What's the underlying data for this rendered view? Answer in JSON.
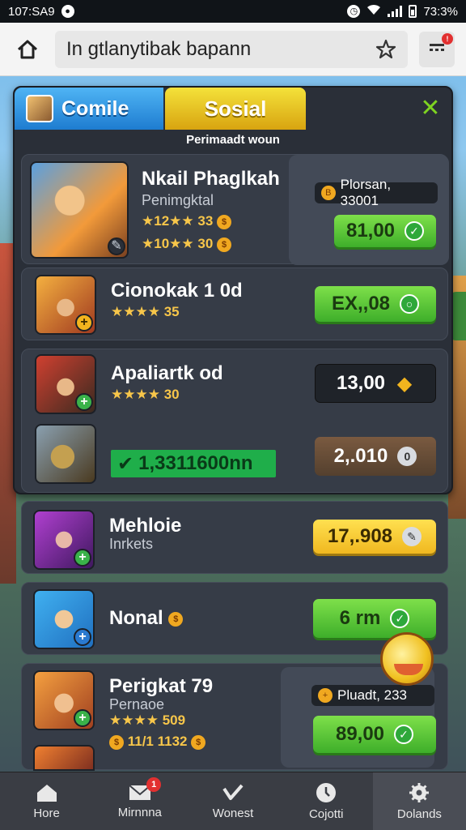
{
  "status_bar": {
    "time": "107:SA9",
    "right_text": "73:3%"
  },
  "browser": {
    "url_text": "In gtlanytibak bapann"
  },
  "panel": {
    "tabs": [
      {
        "label": "Comile"
      },
      {
        "label": "Sosial"
      }
    ],
    "subheader": "Perimaadt woun"
  },
  "items": [
    {
      "title": "Nkail Phaglkah",
      "subtitle": "Penimgktal",
      "rating1": "12",
      "rating1_value": "33",
      "rating2": "10",
      "rating2_value": "30",
      "price_label": "Plorsan, 33001",
      "button": "81,00"
    },
    {
      "title": "Cionokak 1 0d",
      "rating": "35",
      "button": "EX,,08"
    },
    {
      "title": "Apaliartk od",
      "rating": "30",
      "button": "13,00"
    },
    {
      "tag": "1,3311600nn",
      "button": "2,.010"
    },
    {
      "title": "Mehloie",
      "subtitle": "Inrkets",
      "button": "17,.908"
    },
    {
      "title": "Nonal",
      "button": "6 rm"
    },
    {
      "title": "Perigkat 79",
      "subtitle": "Pernaoe",
      "rating": "509",
      "extra_text": "11/1 1132",
      "price_label": "Pluadt, 233",
      "button": "89,00"
    }
  ],
  "bottom_nav": [
    {
      "label": "Hore"
    },
    {
      "label": "Mirnnna",
      "badge": "1"
    },
    {
      "label": "Wonest"
    },
    {
      "label": "Cojotti"
    },
    {
      "label": "Dolands"
    }
  ],
  "colors": {
    "accent_green": "#3eae2a",
    "tab_blue": "#1e7cd0",
    "tab_yellow": "#d8a410",
    "panel_bg": "#2a2f38"
  },
  "icons": {
    "home": "home-icon",
    "star": "star-icon",
    "menu": "menu-icon",
    "close": "close-icon",
    "check": "check-icon"
  }
}
